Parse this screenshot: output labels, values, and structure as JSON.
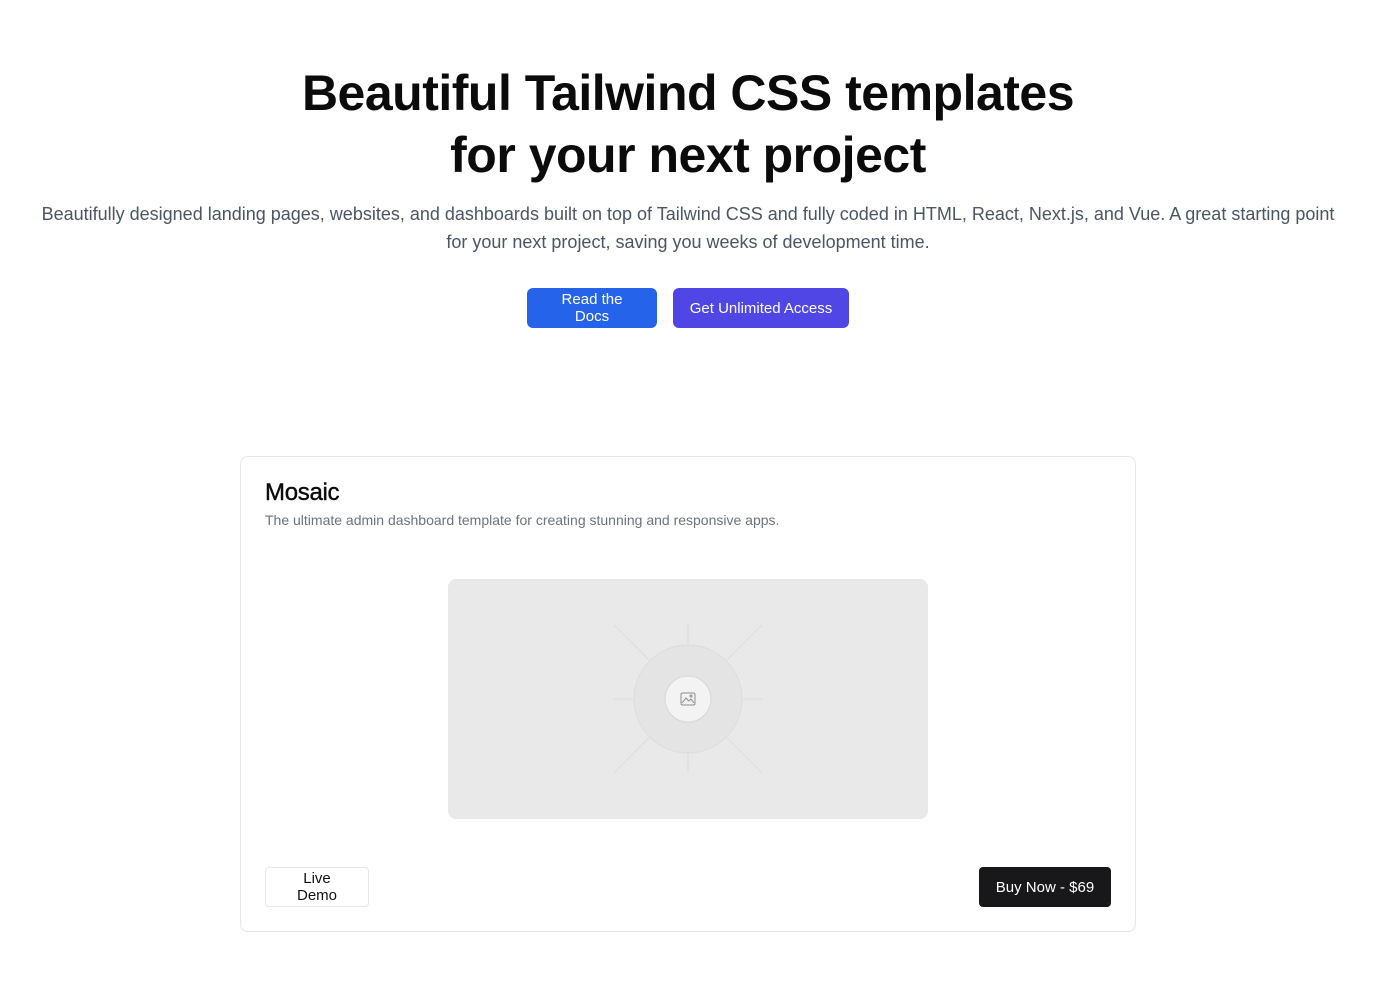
{
  "hero": {
    "title_line1": "Beautiful Tailwind CSS templates",
    "title_line2": "for your next project",
    "subtitle": "Beautifully designed landing pages, websites, and dashboards built on top of Tailwind CSS and fully coded in HTML, React, Next.js, and Vue. A great starting point for your next project, saving you weeks of development time.",
    "docs_button": "Read the Docs",
    "access_button": "Get Unlimited Access"
  },
  "card": {
    "title": "Mosaic",
    "description": "The ultimate admin dashboard template for creating stunning and responsive apps.",
    "image_icon": "image-placeholder-icon",
    "demo_button": "Live Demo",
    "buy_button": "Buy Now - $69"
  },
  "colors": {
    "docs_button_bg": "#2563eb",
    "access_button_bg": "#4f46e5",
    "buy_button_bg": "#18181b",
    "image_placeholder_bg": "#e9e9e9"
  }
}
